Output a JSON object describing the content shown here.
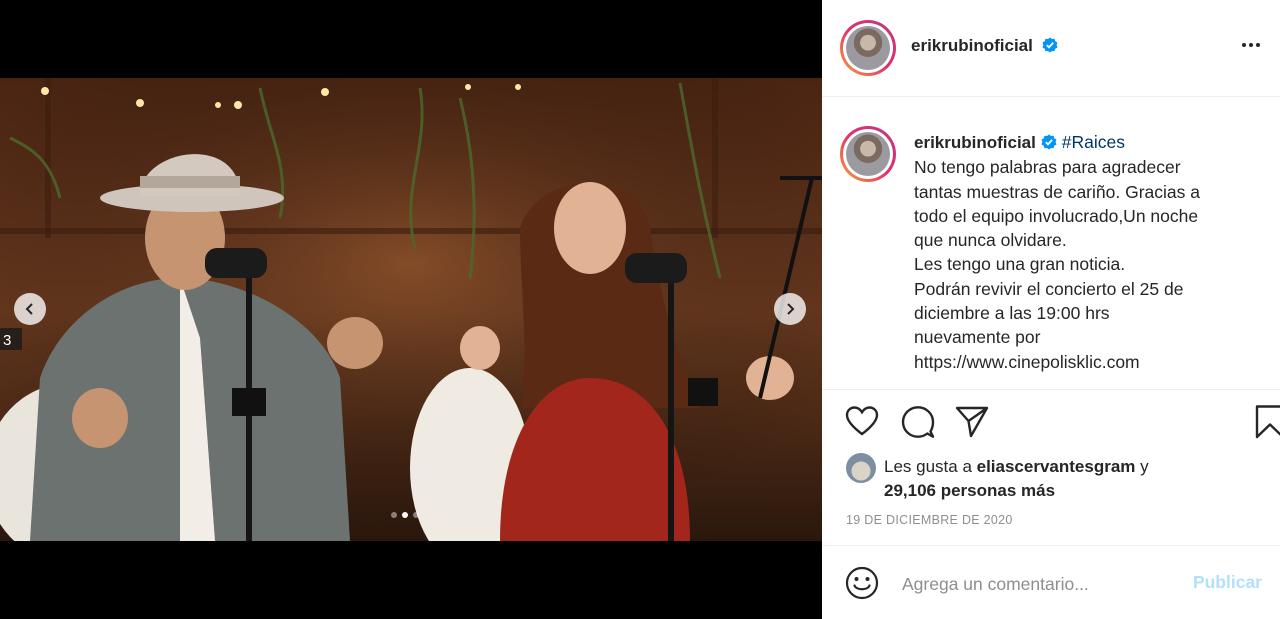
{
  "post": {
    "username": "erikrubinoficial",
    "verified_icon": "verified-badge-icon",
    "more_icon": "more-options-icon"
  },
  "media": {
    "corner_number": "3",
    "carousel_count": 3,
    "carousel_active": 2
  },
  "caption": {
    "username": "erikrubinoficial",
    "hashtag": "#Raices",
    "lines": [
      "No tengo palabras para agradecer",
      "tantas muestras de cariño. Gracias a",
      "todo el equipo involucrado,Un noche",
      "que nunca olvidare.",
      "Les tengo una gran noticia.",
      "Podrán revivir el concierto el 25 de",
      "diciembre a las 19:00 hrs",
      "nuevamente por",
      "https://www.cinepolisklic.com"
    ]
  },
  "likes": {
    "prefix": "Les gusta a ",
    "user": "eliascervantesgram",
    "connector": " y",
    "count_text": "29,106 personas más"
  },
  "date": "19 DE DICIEMBRE DE 2020",
  "comment": {
    "placeholder": "Agrega un comentario...",
    "publish_label": "Publicar"
  },
  "colors": {
    "link": "#00376b",
    "verified": "#0095f6",
    "publish_disabled": "#b2dffc"
  }
}
